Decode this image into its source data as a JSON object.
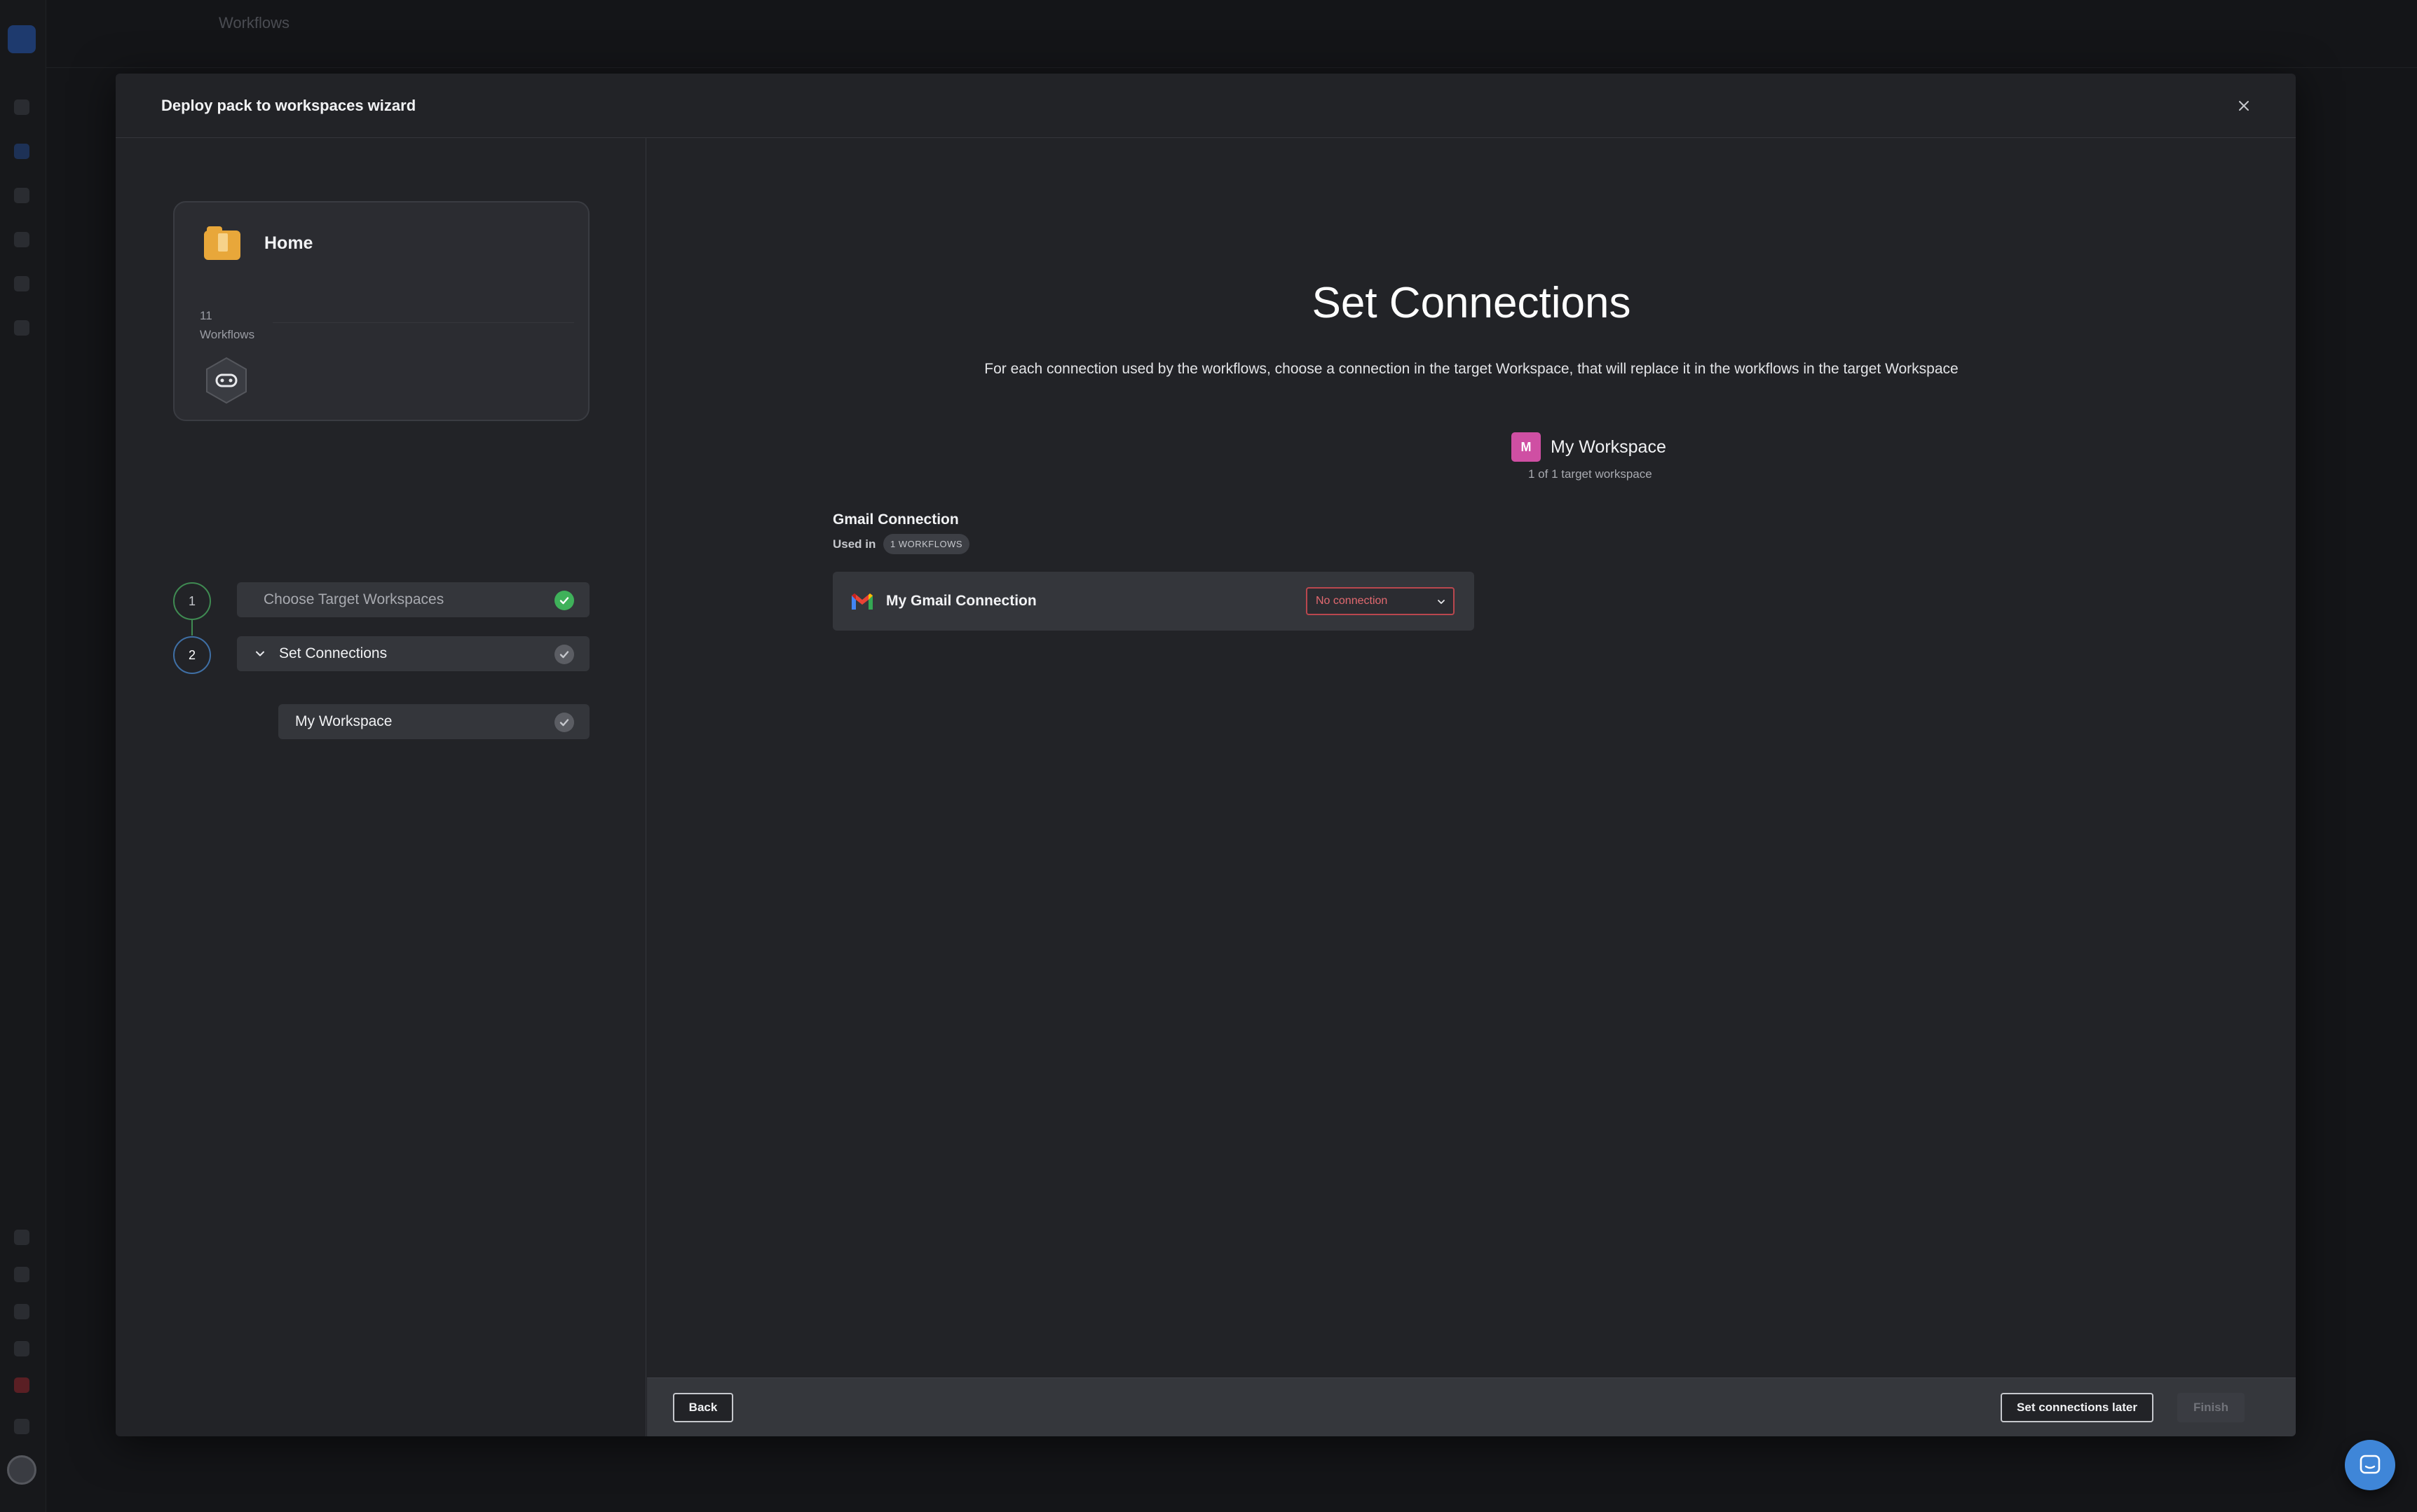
{
  "background": {
    "page_title": "Workflows"
  },
  "modal": {
    "title": "Deploy pack to workspaces wizard"
  },
  "pack": {
    "name": "Home",
    "count": "11",
    "count_label": "Workflows"
  },
  "steps": [
    {
      "number": "1",
      "label": "Choose Target Workspaces",
      "status": "done"
    },
    {
      "number": "2",
      "label": "Set Connections",
      "status": "current",
      "expanded": true
    }
  ],
  "substeps": [
    {
      "label": "My Workspace",
      "status": "pending"
    }
  ],
  "main": {
    "title": "Set Connections",
    "description": "For each connection used by the workflows, choose a connection in the target Workspace, that will replace it in the workflows in the target Workspace"
  },
  "workspace": {
    "avatar_letter": "M",
    "name": "My Workspace",
    "progress": "1 of 1 target workspace"
  },
  "connection": {
    "section_title": "Gmail Connection",
    "used_in_label": "Used in",
    "used_in_badge": "1 WORKFLOWS",
    "name": "My Gmail Connection",
    "select_value": "No connection",
    "icon": "gmail-icon"
  },
  "footer": {
    "back_label": "Back",
    "later_label": "Set connections later",
    "finish_label": "Finish"
  },
  "colors": {
    "accent_blue": "#3f86d8",
    "success_green": "#3fb15a",
    "error_red": "#e36a70",
    "workspace_pink": "#cf4fa3",
    "pack_folder": "#e8a73a"
  }
}
